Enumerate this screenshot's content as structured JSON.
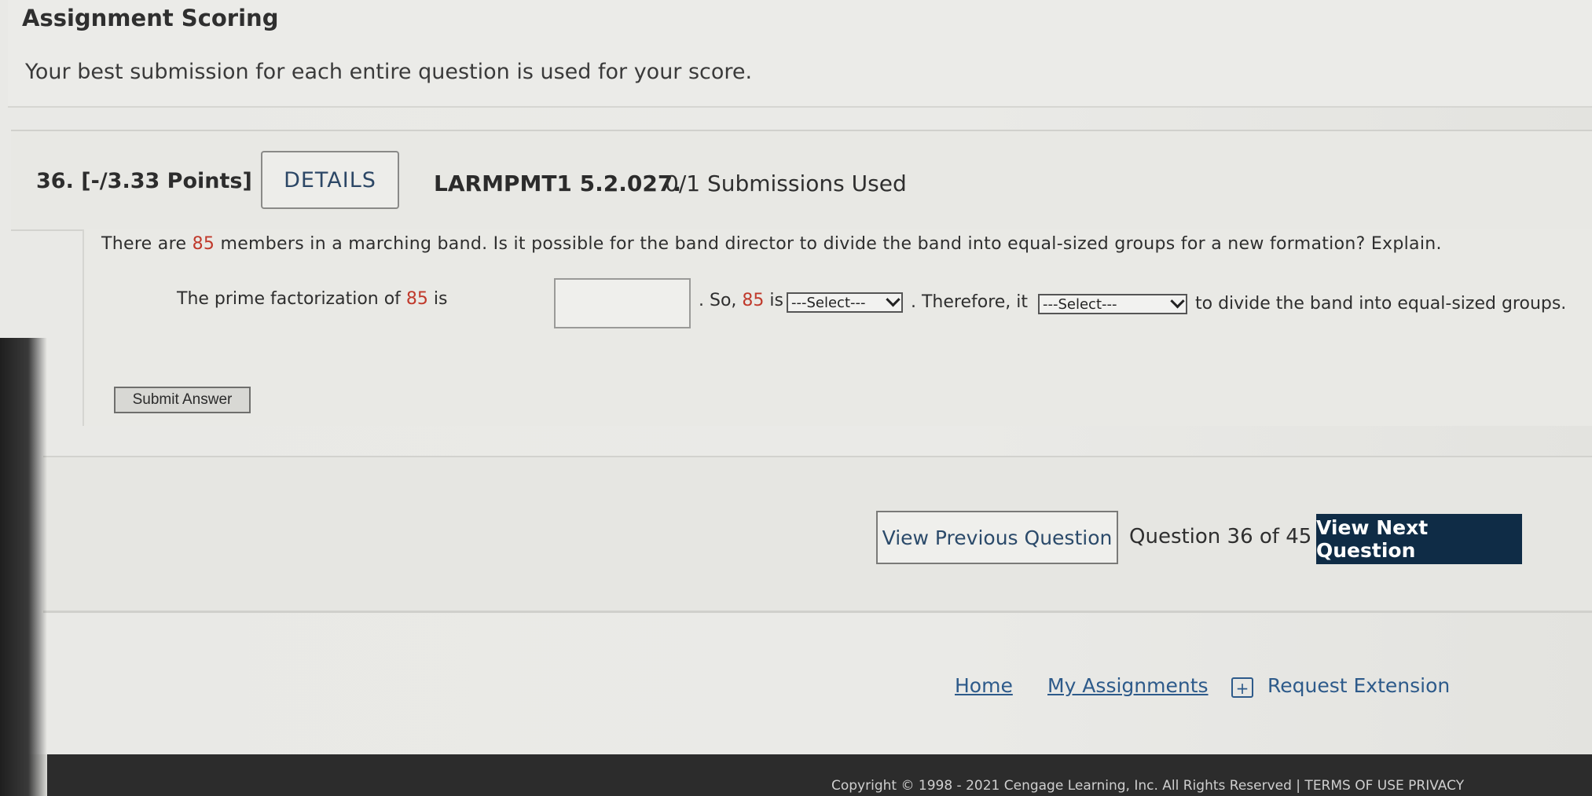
{
  "scoring": {
    "title": "Assignment Scoring",
    "description": "Your best submission for each entire question is used for your score."
  },
  "question": {
    "number": "36.",
    "points": "[-/3.33 Points]",
    "details_label": "DETAILS",
    "code": "LARMPMT1 5.2.027.",
    "submissions": "0/1 Submissions Used",
    "prompt_before": "There are ",
    "prompt_number": "85",
    "prompt_after": " members in a marching band. Is it possible for the band director to divide the band into equal-sized groups for a new formation? Explain.",
    "line_part1": "The prime factorization of ",
    "line_num1": "85",
    "line_part2": " is",
    "answer_value": "",
    "line_part3": ". So, ",
    "line_num2": "85",
    "line_part4": " is",
    "select1_value": "---Select---",
    "line_part5": ". Therefore, it",
    "select2_value": "---Select---",
    "line_part6": "to divide the band into equal-sized groups.",
    "submit_label": "Submit Answer"
  },
  "navigation": {
    "prev_label": "View Previous Question",
    "counter": "Question 36 of 45",
    "next_label": "View Next Question"
  },
  "footer": {
    "home": "Home",
    "my_assignments": "My Assignments",
    "extension_icon": "+",
    "request_extension": "Request Extension",
    "copyright": "Copyright © 1998 - 2021 Cengage Learning, Inc. All Rights Reserved  |  TERMS OF USE  PRIVACY"
  },
  "colors": {
    "highlight_number": "#c0392b",
    "next_button_bg": "#0f2c46",
    "link": "#2d5a8a"
  }
}
